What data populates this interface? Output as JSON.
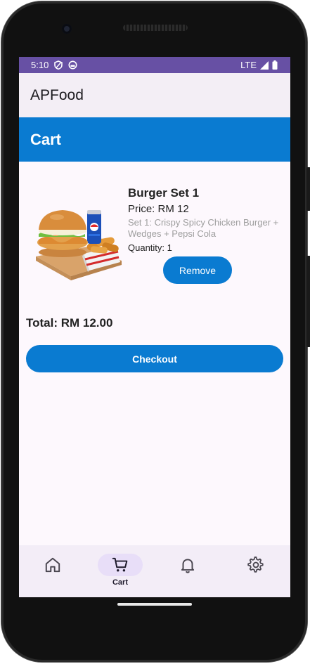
{
  "status_bar": {
    "time": "5:10",
    "network": "LTE",
    "icons": [
      "shield-icon",
      "circle-app-icon",
      "signal-icon",
      "battery-icon"
    ]
  },
  "app_bar": {
    "title": "APFood"
  },
  "cart_header": {
    "title": "Cart"
  },
  "cart_item": {
    "name": "Burger Set 1",
    "price": "Price: RM 12",
    "description": "Set 1: Crispy Spicy Chicken Burger + Wedges + Pepsi Cola",
    "quantity": "Quantity: 1",
    "remove_label": "Remove",
    "image": "burger-set-image"
  },
  "total": "Total: RM 12.00",
  "checkout_label": "Checkout",
  "bottom_nav": {
    "items": [
      {
        "icon": "home-icon",
        "label": ""
      },
      {
        "icon": "cart-icon",
        "label": "Cart",
        "selected": true
      },
      {
        "icon": "bell-icon",
        "label": ""
      },
      {
        "icon": "gear-icon",
        "label": ""
      }
    ]
  },
  "colors": {
    "status_bar": "#6750a4",
    "primary_blue": "#0a7bd1",
    "app_bar": "#f3eef5",
    "nav_background": "#f3edf7",
    "nav_indicator": "#e8def8"
  }
}
